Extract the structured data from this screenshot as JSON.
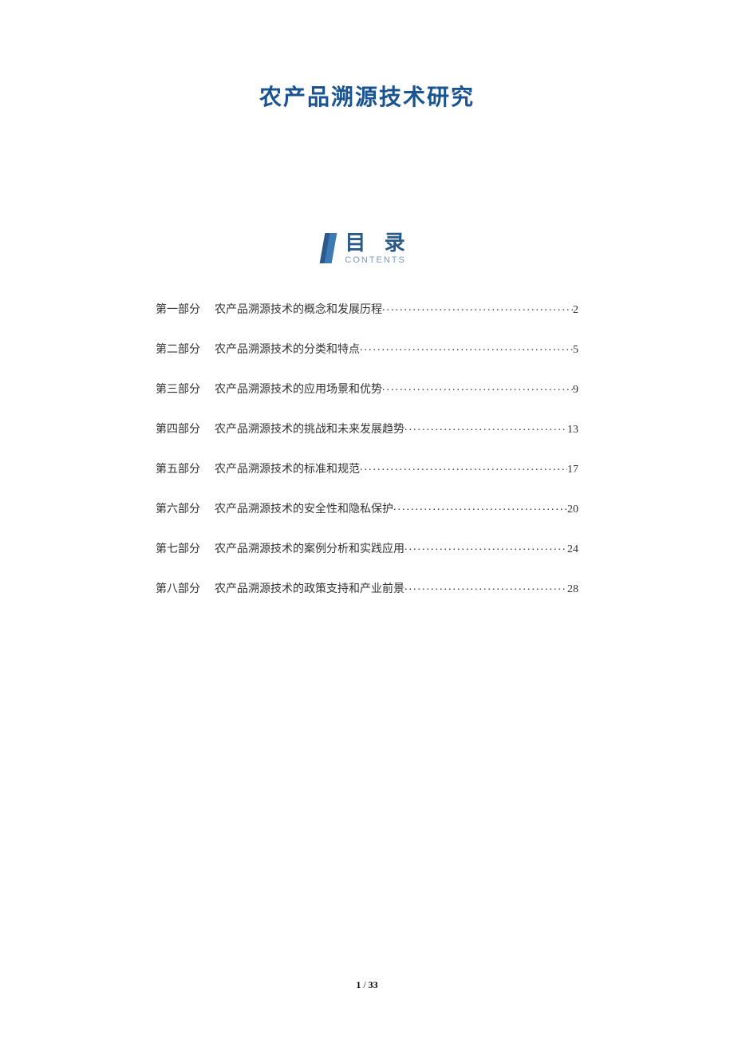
{
  "title": "农产品溯源技术研究",
  "toc_header": {
    "cn": "目 录",
    "en": "CONTENTS"
  },
  "toc": [
    {
      "part": "第一部分",
      "text": "农产品溯源技术的概念和发展历程",
      "page": "2"
    },
    {
      "part": "第二部分",
      "text": "农产品溯源技术的分类和特点",
      "page": "5"
    },
    {
      "part": "第三部分",
      "text": "农产品溯源技术的应用场景和优势",
      "page": "9"
    },
    {
      "part": "第四部分",
      "text": "农产品溯源技术的挑战和未来发展趋势",
      "page": "13"
    },
    {
      "part": "第五部分",
      "text": "农产品溯源技术的标准和规范",
      "page": "17"
    },
    {
      "part": "第六部分",
      "text": "农产品溯源技术的安全性和隐私保护",
      "page": "20"
    },
    {
      "part": "第七部分",
      "text": "农产品溯源技术的案例分析和实践应用",
      "page": "24"
    },
    {
      "part": "第八部分",
      "text": "农产品溯源技术的政策支持和产业前景",
      "page": "28"
    }
  ],
  "footer": {
    "current": "1",
    "sep": " / ",
    "total": "33"
  }
}
